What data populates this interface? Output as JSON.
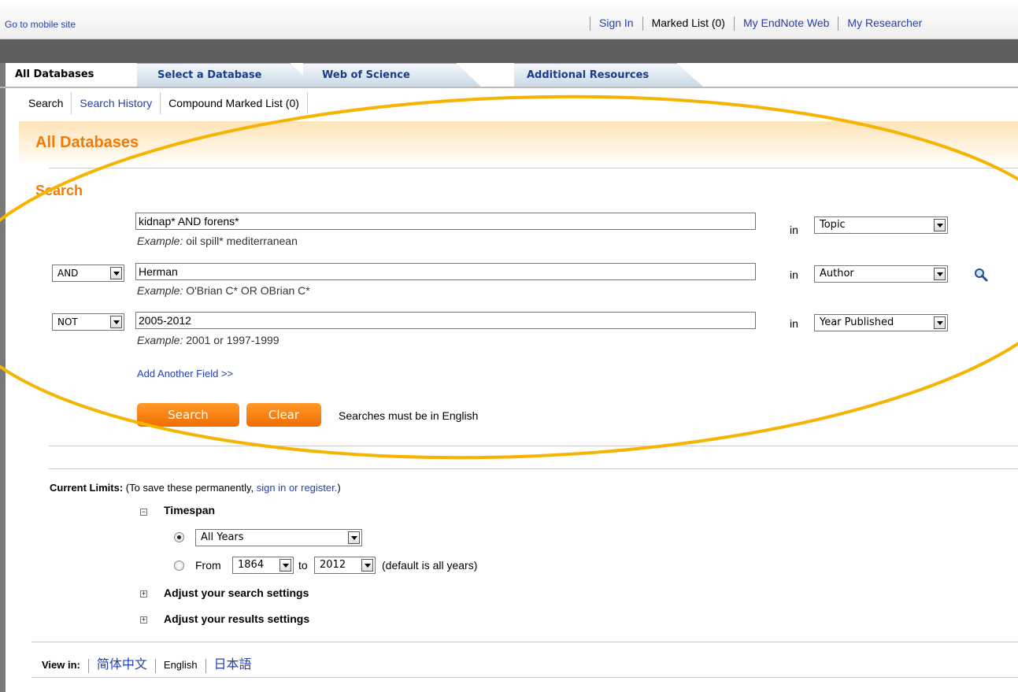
{
  "topbar": {
    "mobile_link": "Go to mobile site",
    "sign_in": "Sign In",
    "marked_list": "Marked List (0)",
    "endnote": "My EndNote Web",
    "researcher": "My Researcher"
  },
  "tabs": [
    {
      "label": "All Databases"
    },
    {
      "label": "Select a Database"
    },
    {
      "label": "Web of Science"
    },
    {
      "label": "Additional Resources"
    }
  ],
  "subnav": {
    "search": "Search",
    "history": "Search History",
    "compound": "Compound Marked List (0)"
  },
  "page_title": "All Databases",
  "search_title": "Search",
  "rows": [
    {
      "operator": "",
      "value": "kidnap* AND forens*",
      "example_label": "Example:",
      "example": " oil spill* mediterranean",
      "in": "in",
      "field": "Topic"
    },
    {
      "operator": "AND",
      "value": "Herman",
      "example_label": "Example:",
      "example": " O'Brian C* OR OBrian C*",
      "in": "in",
      "field": "Author"
    },
    {
      "operator": "NOT",
      "value": "2005-2012",
      "example_label": "Example:",
      "example": " 2001 or 1997-1999",
      "in": "in",
      "field": "Year Published"
    }
  ],
  "add_field": "Add Another Field >>",
  "buttons": {
    "search": "Search",
    "clear": "Clear",
    "note": "Searches must be in English"
  },
  "limits": {
    "label": "Current Limits:",
    "text": " (To save these permanently, ",
    "link": "sign in or register.",
    "close": ")",
    "timespan": "Timespan",
    "all_years": "All Years",
    "from": "From",
    "from_year": "1864",
    "to": "to",
    "to_year": "2012",
    "default_note": "(default is all years)",
    "search_settings": "Adjust your search settings",
    "results_settings": "Adjust your results settings"
  },
  "view_in": {
    "label": "View in:",
    "chinese": "简体中文",
    "english": "English",
    "japanese": "日本語"
  },
  "colors": {
    "accent_orange": "#f07b05",
    "link_blue": "#2440b3",
    "annotation": "#f5b400"
  }
}
